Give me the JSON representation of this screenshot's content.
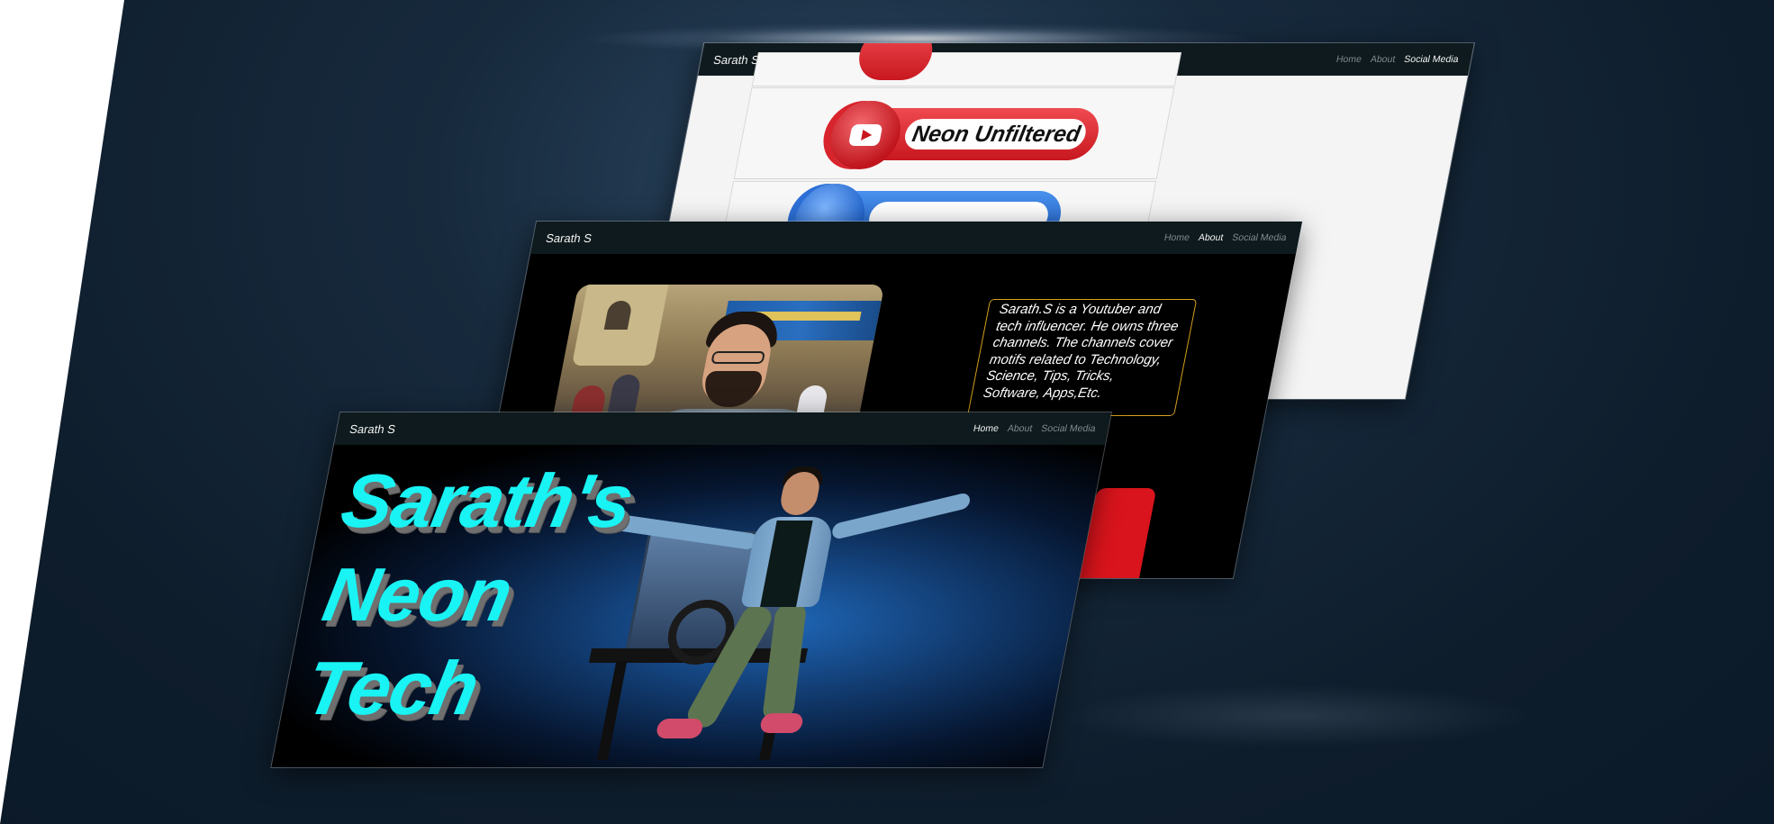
{
  "screens": {
    "social": {
      "brand": "Sarath S",
      "nav": [
        "Home",
        "About",
        "Social Media"
      ],
      "active_nav": "Social Media",
      "channels": [
        "Neon Unfiltered"
      ]
    },
    "about": {
      "brand": "Sarath S",
      "nav": [
        "Home",
        "About",
        "Social Media"
      ],
      "active_nav": "About",
      "bio": "Sarath.S is a Youtuber and tech influencer. He owns three channels. The channels cover motifs related to Technology, Science, Tips, Tricks, Software, Apps,Etc."
    },
    "home": {
      "brand": "Sarath S",
      "nav": [
        "Home",
        "About",
        "Social Media"
      ],
      "active_nav": "Home",
      "hero_lines": [
        "Sarath's",
        "Neon",
        "Tech"
      ]
    }
  },
  "colors": {
    "navbar": "#0e1a1d",
    "hero_text": "#19f3f3",
    "bio_border": "#d8a21c",
    "youtube_red": "#c8171f",
    "backdrop": "#0e1d2c"
  }
}
